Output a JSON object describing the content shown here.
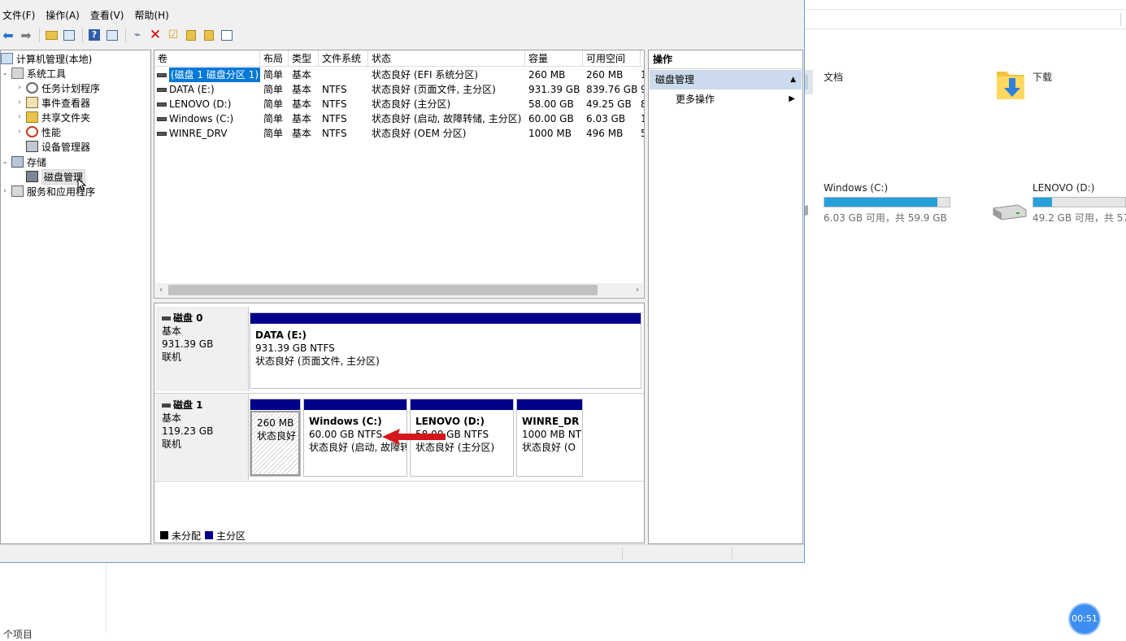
{
  "explorer": {
    "folders": [
      {
        "label": "文档",
        "icon": "document-folder-icon"
      },
      {
        "label": "下载",
        "icon": "download-folder-icon"
      }
    ],
    "drives": [
      {
        "name": "Windows (C:)",
        "free_text": "6.03 GB 可用，共 59.9 GB",
        "used_fraction": 0.9
      },
      {
        "name": "LENOVO (D:)",
        "free_text": "49.2 GB 可用，共 57",
        "used_fraction": 0.15
      }
    ],
    "item_count": "个项目"
  },
  "timer": "00:51",
  "menubar": [
    "文件(F)",
    "操作(A)",
    "查看(V)",
    "帮助(H)"
  ],
  "toolbar": [
    "back-arrow-icon",
    "forward-arrow-icon",
    "up-folder-icon",
    "show-hide-tree-icon",
    "help-icon",
    "properties-icon",
    "connect-icon",
    "delete-icon",
    "check-icon",
    "export-icon",
    "search-folder-icon",
    "console-icon"
  ],
  "tree": {
    "root": "计算机管理(本地)",
    "system_tools": "系统工具",
    "task_scheduler": "任务计划程序",
    "event_viewer": "事件查看器",
    "shared_folders": "共享文件夹",
    "performance": "性能",
    "device_manager": "设备管理器",
    "storage": "存储",
    "disk_management": "磁盘管理",
    "services": "服务和应用程序"
  },
  "volume_list": {
    "columns": [
      "卷",
      "布局",
      "类型",
      "文件系统",
      "状态",
      "容量",
      "可用空间",
      "%"
    ],
    "rows": [
      {
        "name": "(磁盘 1 磁盘分区 1)",
        "layout": "简单",
        "type": "基本",
        "fs": "",
        "status": "状态良好 (EFI 系统分区)",
        "capacity": "260 MB",
        "free": "260 MB",
        "pct": "1"
      },
      {
        "name": "DATA (E:)",
        "layout": "简单",
        "type": "基本",
        "fs": "NTFS",
        "status": "状态良好 (页面文件, 主分区)",
        "capacity": "931.39 GB",
        "free": "839.76 GB",
        "pct": "9"
      },
      {
        "name": "LENOVO (D:)",
        "layout": "简单",
        "type": "基本",
        "fs": "NTFS",
        "status": "状态良好 (主分区)",
        "capacity": "58.00 GB",
        "free": "49.25 GB",
        "pct": "8"
      },
      {
        "name": "Windows (C:)",
        "layout": "简单",
        "type": "基本",
        "fs": "NTFS",
        "status": "状态良好 (启动, 故障转储, 主分区)",
        "capacity": "60.00 GB",
        "free": "6.03 GB",
        "pct": "1"
      },
      {
        "name": "WINRE_DRV",
        "layout": "简单",
        "type": "基本",
        "fs": "NTFS",
        "status": "状态良好 (OEM 分区)",
        "capacity": "1000 MB",
        "free": "496 MB",
        "pct": "5"
      }
    ]
  },
  "disks": [
    {
      "name": "磁盘 0",
      "type": "基本",
      "size": "931.39 GB",
      "state": "联机",
      "partitions": [
        {
          "name": "DATA  (E:)",
          "size": "931.39 GB NTFS",
          "status": "状态良好 (页面文件, 主分区)"
        }
      ]
    },
    {
      "name": "磁盘 1",
      "type": "基本",
      "size": "119.23 GB",
      "state": "联机",
      "partitions": [
        {
          "name": "",
          "size": "260 MB",
          "status": "状态良好"
        },
        {
          "name": "Windows  (C:)",
          "size": "60.00 GB NTFS",
          "status": "状态良好 (启动, 故障转储"
        },
        {
          "name": "LENOVO  (D:)",
          "size": "58.00 GB NTFS",
          "status": "状态良好 (主分区)"
        },
        {
          "name": "WINRE_DR",
          "size": "1000 MB NT",
          "status": "状态良好 (O"
        }
      ]
    }
  ],
  "legend": [
    {
      "label": "未分配",
      "color": "#000000"
    },
    {
      "label": "主分区",
      "color": "#00008b"
    }
  ],
  "actions": {
    "header": "操作",
    "section": "磁盘管理",
    "more": "更多操作"
  }
}
